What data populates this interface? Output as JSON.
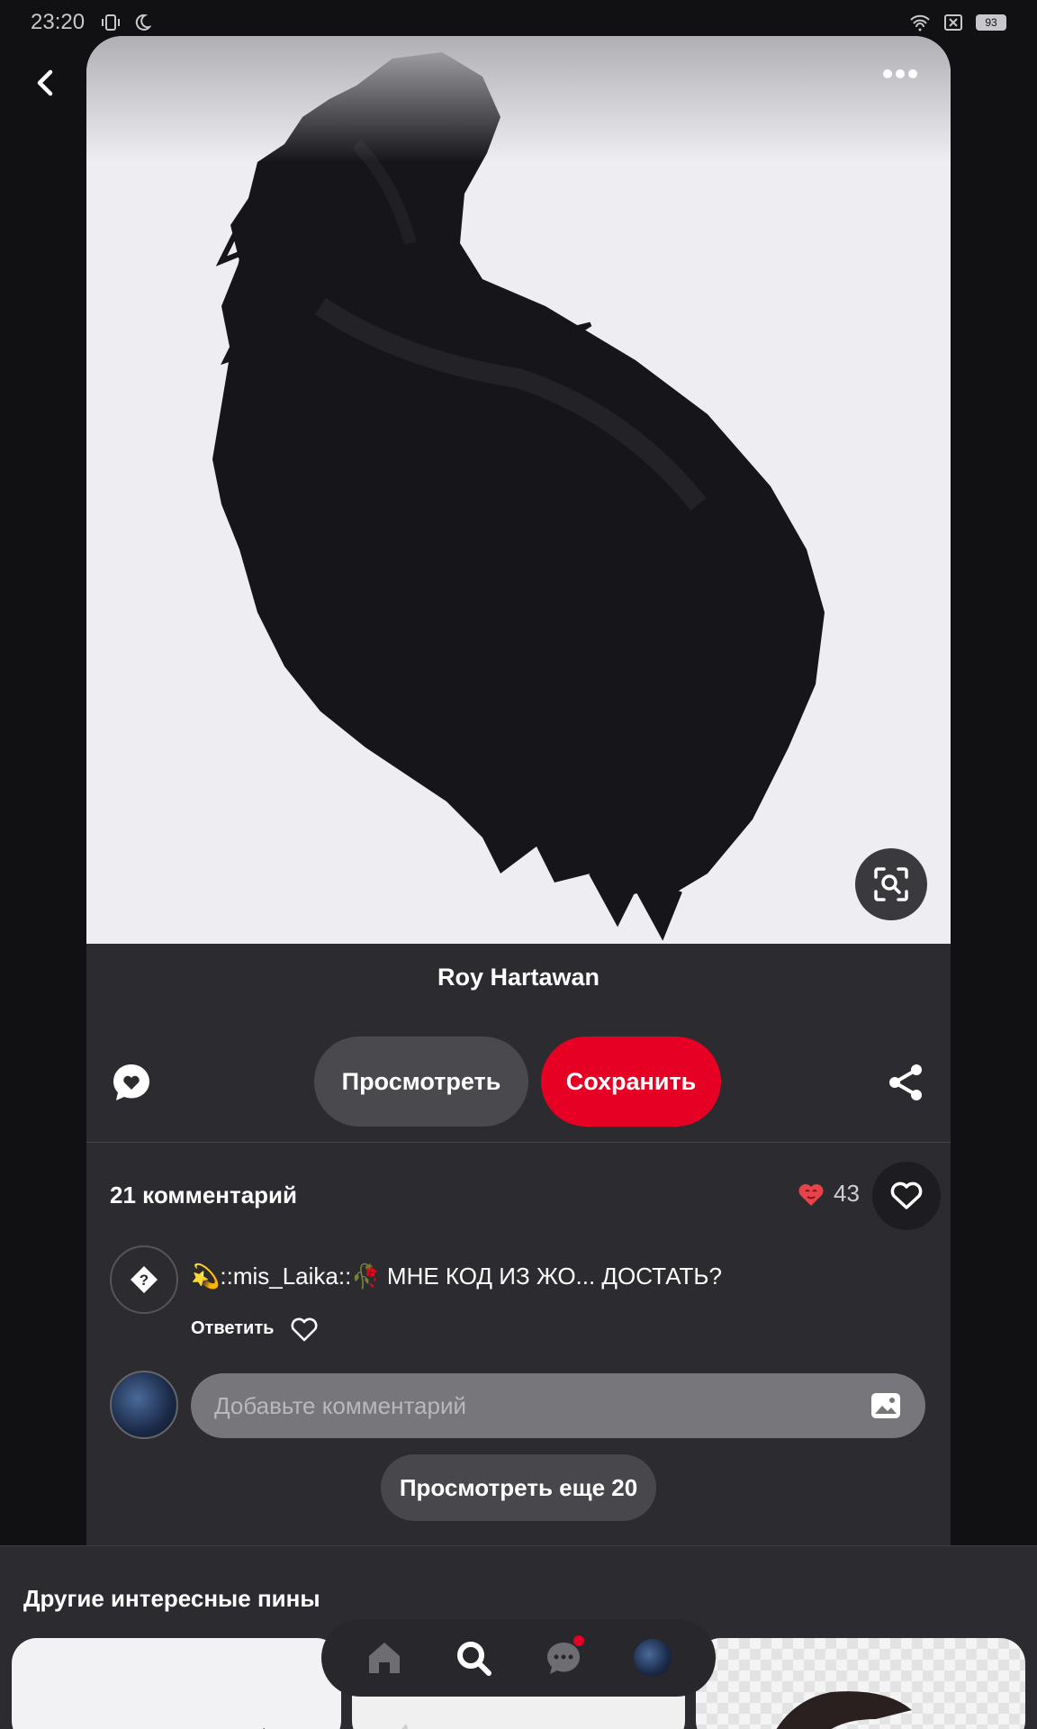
{
  "status_bar": {
    "time": "23:20",
    "battery": "93"
  },
  "pin": {
    "author": "Roy Hartawan",
    "view_label": "Просмотреть",
    "save_label": "Сохранить"
  },
  "comments": {
    "header": "21 комментарий",
    "reaction_count": "43",
    "items": [
      {
        "author": "💫::mis_Laika::🥀",
        "text": " МНЕ КОД ИЗ ЖО... ДОСТАТЬ?",
        "reply_label": "Ответить"
      }
    ],
    "input_placeholder": "Добавьте комментарий",
    "more_label": "Просмотреть еще 20"
  },
  "more_pins": {
    "title": "Другие интересные пины"
  },
  "colors": {
    "accent": "#e60023",
    "card": "#2c2b2f",
    "background": "#111114"
  },
  "icons": {
    "back": "back-arrow-icon",
    "more": "more-dots-icon",
    "lens": "visual-search-icon",
    "react": "heart-bubble-icon",
    "share": "share-icon",
    "heart": "heart-outline-icon",
    "nav": [
      "home-icon",
      "search-icon",
      "messages-icon",
      "profile-avatar"
    ]
  }
}
